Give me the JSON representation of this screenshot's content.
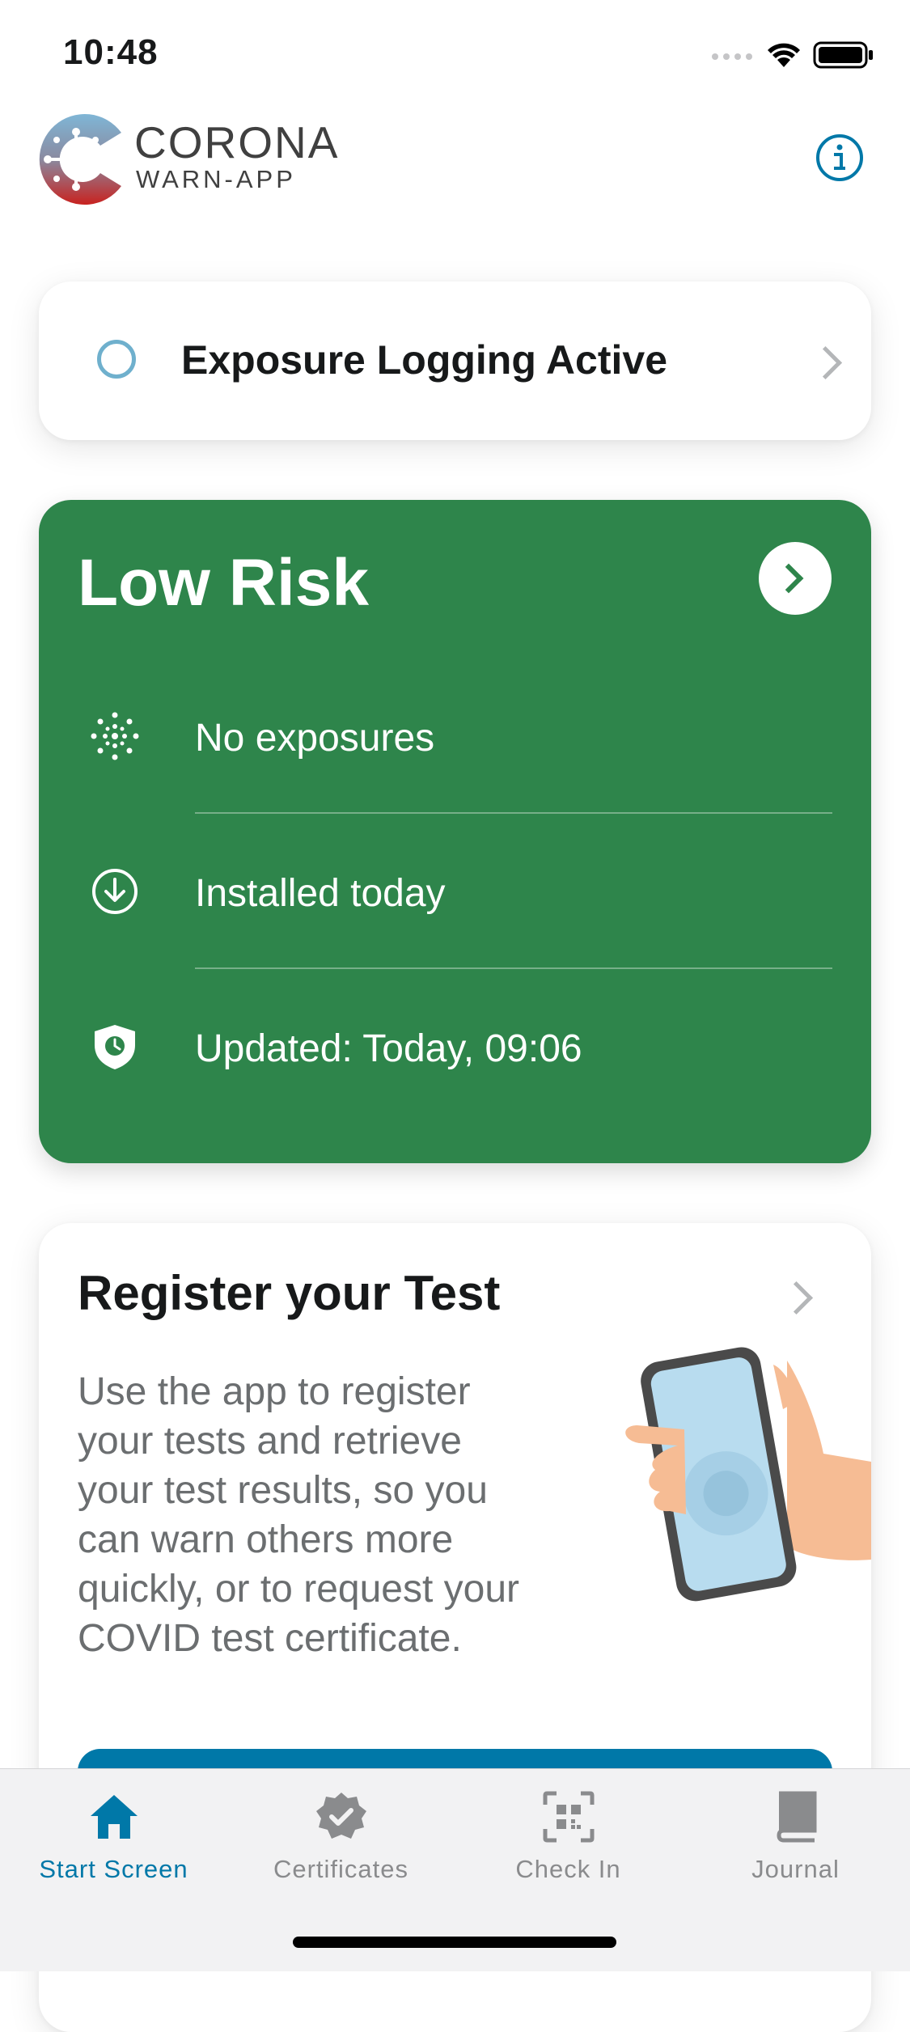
{
  "status_bar": {
    "time": "10:48",
    "icons": [
      "signal-icon",
      "wifi-icon",
      "battery-icon"
    ]
  },
  "header": {
    "logo_line1": "CORONA",
    "logo_line2": "WARN-APP",
    "info_icon": "info-icon"
  },
  "exposure_logging": {
    "label": "Exposure Logging Active"
  },
  "risk_card": {
    "title": "Low Risk",
    "background_color": "#2e854b",
    "rows": [
      {
        "icon": "virus-icon",
        "label": "No exposures"
      },
      {
        "icon": "download-icon",
        "label": "Installed today"
      },
      {
        "icon": "shield-clock-icon",
        "label": "Updated: Today, 09:06"
      }
    ]
  },
  "test_card": {
    "title": "Register your Test",
    "body": "Use the app to register your tests and retrieve your test results, so you can warn others more quickly, or to request your COVID test certificate.",
    "button_color": "#0078a8"
  },
  "tab_bar": {
    "accent_color": "#0078a8",
    "tabs": [
      {
        "label": "Start Screen",
        "icon": "home-icon",
        "active": true
      },
      {
        "label": "Certificates",
        "icon": "certificate-icon",
        "active": false
      },
      {
        "label": "Check In",
        "icon": "qr-scan-icon",
        "active": false
      },
      {
        "label": "Journal",
        "icon": "journal-icon",
        "active": false
      }
    ]
  }
}
